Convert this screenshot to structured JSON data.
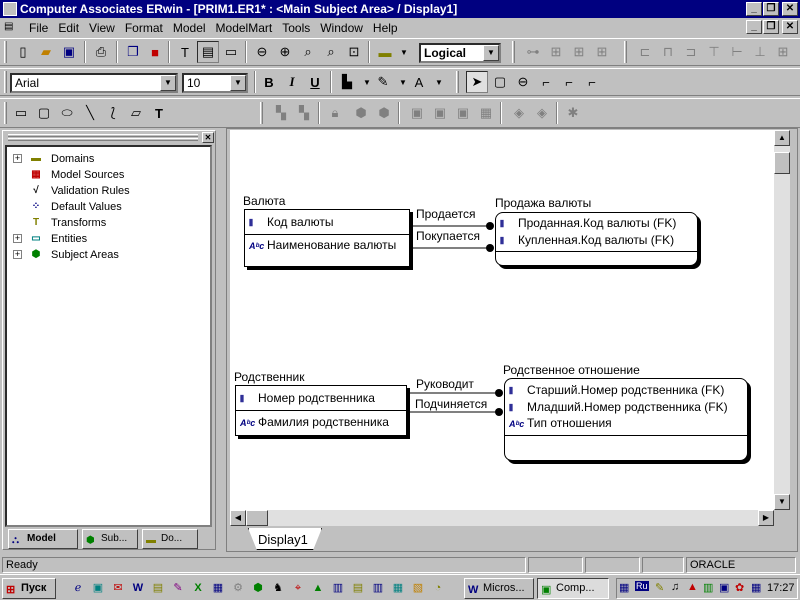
{
  "window": {
    "title": "Computer Associates ERwin - [PRIM1.ER1* : <Main Subject Area> / Display1]"
  },
  "menu": [
    "File",
    "Edit",
    "View",
    "Format",
    "Model",
    "ModelMart",
    "Tools",
    "Window",
    "Help"
  ],
  "toolbar": {
    "view_mode": "Logical",
    "font_name": "Arial",
    "font_size": "10",
    "bold": "B",
    "italic": "I",
    "underline": "U"
  },
  "tree": {
    "items": [
      {
        "label": "Domains",
        "icon": "domain-icon",
        "expandable": true
      },
      {
        "label": "Model Sources",
        "icon": "model-sources-icon",
        "expandable": false
      },
      {
        "label": "Validation Rules",
        "icon": "validation-icon",
        "expandable": false
      },
      {
        "label": "Default Values",
        "icon": "default-values-icon",
        "expandable": false
      },
      {
        "label": "Transforms",
        "icon": "transforms-icon",
        "expandable": false
      },
      {
        "label": "Entities",
        "icon": "entities-icon",
        "expandable": true
      },
      {
        "label": "Subject Areas",
        "icon": "subject-areas-icon",
        "expandable": true
      }
    ]
  },
  "bottom_tabs": [
    "Model",
    "Sub...",
    "Do..."
  ],
  "diagram": {
    "tab": "Display1",
    "entities": [
      {
        "name": "Валюта",
        "keys": [
          "Код валюты"
        ],
        "attrs": [
          "Наименование валюты"
        ]
      },
      {
        "name": "Продажа валюты",
        "keys": [
          "Проданная.Код валюты (FK)",
          "Купленная.Код валюты (FK)"
        ],
        "attrs": []
      },
      {
        "name": "Родственник",
        "keys": [
          "Номер родственника"
        ],
        "attrs": [
          "Фамилия родственника"
        ]
      },
      {
        "name": "Родственное отношение",
        "keys": [
          "Старший.Номер родственника (FK)",
          "Младший.Номер родственника (FK)"
        ],
        "attrs": [
          "Тип отношения"
        ]
      }
    ],
    "relationships": [
      "Продается",
      "Покупается",
      "Руководит",
      "Подчиняется"
    ]
  },
  "status": {
    "text": "Ready",
    "db": "ORACLE"
  },
  "taskbar": {
    "start": "Пуск",
    "tasks": [
      "Micros...",
      "Comp..."
    ],
    "clock": "17:27"
  }
}
